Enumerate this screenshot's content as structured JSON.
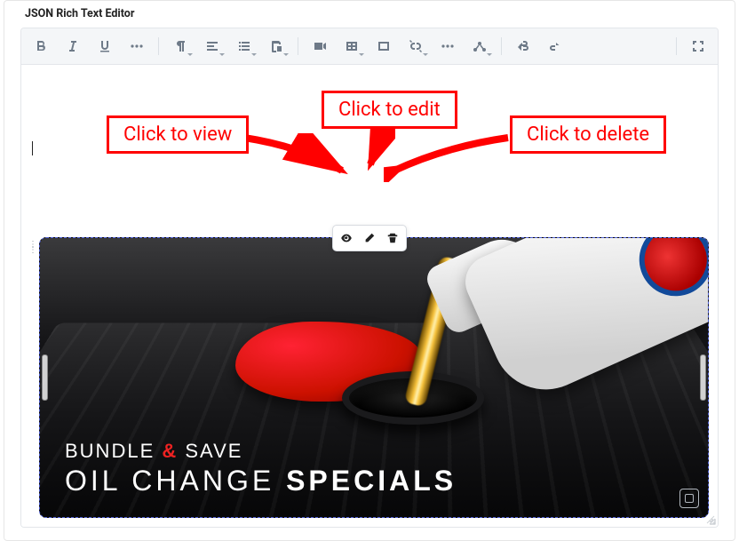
{
  "panel": {
    "title": "JSON Rich Text Editor"
  },
  "toolbar": {
    "buttons": [
      {
        "name": "bold-button",
        "icon": "bold"
      },
      {
        "name": "italic-button",
        "icon": "italic"
      },
      {
        "name": "underline-button",
        "icon": "underline"
      },
      {
        "name": "more-format-button",
        "icon": "dots"
      },
      {
        "sep": true
      },
      {
        "name": "paragraph-button",
        "icon": "paragraph",
        "dropdown": true
      },
      {
        "name": "align-button",
        "icon": "align",
        "dropdown": true
      },
      {
        "name": "list-button",
        "icon": "list",
        "dropdown": true
      },
      {
        "name": "paste-button",
        "icon": "paste",
        "dropdown": true
      },
      {
        "sep": true
      },
      {
        "name": "video-button",
        "icon": "video"
      },
      {
        "name": "table-button",
        "icon": "table",
        "dropdown": true
      },
      {
        "name": "insert-button",
        "icon": "insert"
      },
      {
        "name": "link-button",
        "icon": "unlink",
        "dropdown": true
      },
      {
        "name": "more-insert-button",
        "icon": "dots"
      },
      {
        "name": "connector-button",
        "icon": "connector",
        "dropdown": true
      },
      {
        "sep": true
      },
      {
        "name": "undo-button",
        "icon": "undo"
      },
      {
        "name": "redo-button",
        "icon": "redo"
      },
      {
        "sep": true
      },
      {
        "name": "fullscreen-button",
        "icon": "fullscreen"
      }
    ]
  },
  "floating_toolbar": {
    "view": {
      "name": "view-button",
      "icon": "eye-icon"
    },
    "edit": {
      "name": "edit-button",
      "icon": "pencil-icon"
    },
    "delete": {
      "name": "delete-button",
      "icon": "trash-icon"
    }
  },
  "image_overlay": {
    "line1_pre": "BUNDLE ",
    "line1_amp": "&",
    "line1_post": " SAVE",
    "line2_thin": "OIL CHANGE ",
    "line2_bold": "SPECIALS"
  },
  "callouts": {
    "view": "Click to view",
    "edit": "Click to edit",
    "delete": "Click to delete"
  },
  "colors": {
    "annotation": "#ff0000",
    "selection_border": "#4e5fd6"
  }
}
